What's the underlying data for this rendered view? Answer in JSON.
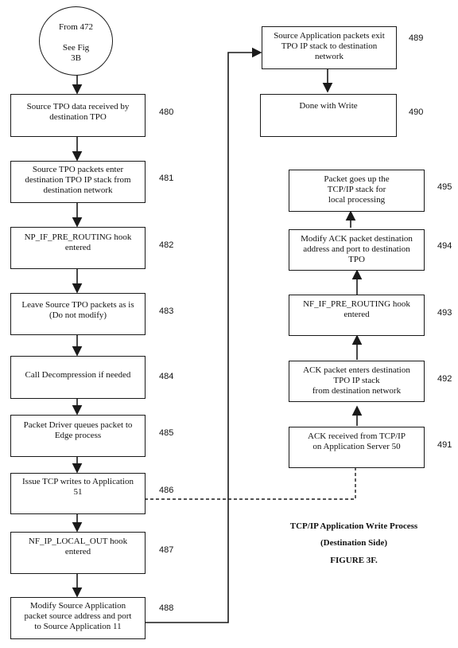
{
  "figure": {
    "caption_line1": "TCP/IP Application Write Process",
    "caption_line2": "(Destination Side)",
    "caption_line3": "FIGURE 3F."
  },
  "connector": {
    "line1": "From 472",
    "line2": "See Fig",
    "line3": "3B"
  },
  "steps": [
    {
      "ref": "480",
      "text": "Source TPO data received by\ndestination TPO"
    },
    {
      "ref": "481",
      "text": "Source TPO packets enter\ndestination TPO IP stack from\ndestination network"
    },
    {
      "ref": "482",
      "text": "NP_IF_PRE_ROUTING hook\nentered"
    },
    {
      "ref": "483",
      "text": "Leave Source TPO packets as is\n(Do not modify)"
    },
    {
      "ref": "484",
      "text": "Call Decompression if needed"
    },
    {
      "ref": "485",
      "text": "Packet Driver queues packet to\nEdge process"
    },
    {
      "ref": "486",
      "text": "Issue TCP writes to Application\n51"
    },
    {
      "ref": "487",
      "text": "NF_IP_LOCAL_OUT hook\nentered"
    },
    {
      "ref": "488",
      "text": "Modify Source Application\npacket source address and port\nto Source Application 11"
    },
    {
      "ref": "489",
      "text": "Source Application packets exit\nTPO IP stack to destination\nnetwork"
    },
    {
      "ref": "490",
      "text": "Done with Write"
    },
    {
      "ref": "491",
      "text": "ACK received from TCP/IP\non Application Server 50"
    },
    {
      "ref": "492",
      "text": "ACK packet enters destination\nTPO IP stack\nfrom destination network"
    },
    {
      "ref": "493",
      "text": "NF_IF_PRE_ROUTING hook\nentered"
    },
    {
      "ref": "494",
      "text": "Modify ACK packet destination\naddress and port to destination\nTPO"
    },
    {
      "ref": "495",
      "text": "Packet goes up the\nTCP/IP stack for\nlocal processing"
    }
  ]
}
